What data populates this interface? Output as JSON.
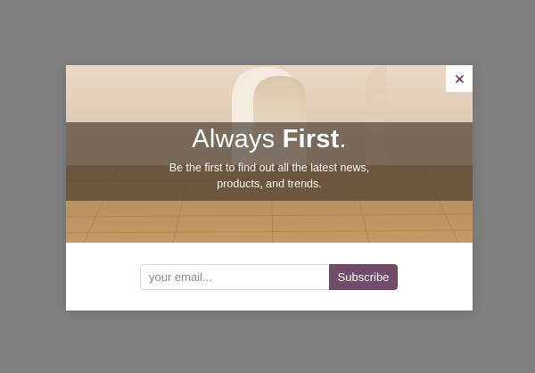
{
  "popup": {
    "headline_regular": "Always ",
    "headline_bold": "First",
    "headline_end": ".",
    "subtitle": "Be the first to find out all the latest news, products, and trends.",
    "close_icon": "close-icon",
    "email_placeholder": "your email...",
    "email_value": "",
    "subscribe_label": "Subscribe"
  },
  "colors": {
    "overlay": "#808080",
    "accent": "#714b67",
    "band": "#4a3c30"
  }
}
